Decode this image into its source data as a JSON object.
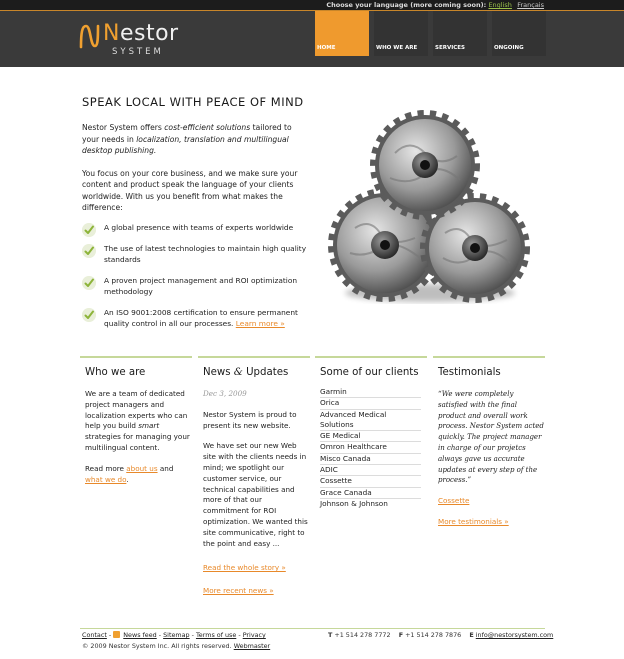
{
  "language_bar": {
    "prompt": "Choose your language (more coming soon):",
    "english": "English",
    "french": "Français"
  },
  "logo": {
    "name_initial": "N",
    "name_rest": "estor",
    "tagline": "SYSTEM"
  },
  "nav": [
    {
      "label": "HOME",
      "active": true
    },
    {
      "label": "WHO WE ARE",
      "active": false
    },
    {
      "label": "SERVICES",
      "active": false
    },
    {
      "label": "ONGOING",
      "active": false
    }
  ],
  "hero": {
    "title": "SPEAK LOCAL WITH PEACE OF MIND",
    "p1": {
      "a": "Nestor System offers ",
      "b": "cost-efficient solutions",
      "c": " tailored to your needs in ",
      "d": "localization, translation and multilingual desktop publishing."
    },
    "p2": "You focus on your core business, and we make sure your content and product speak the language of your clients worldwide. With us you benefit from what makes the difference:",
    "benefits": [
      "A global presence with teams of experts worldwide",
      "The use of latest technologies to maintain high quality standards",
      "A proven project management and ROI optimization methodology",
      "An ISO 9001:2008 certification to ensure permanent quality control in all our processes."
    ],
    "learn_more": "Learn more »"
  },
  "who": {
    "title": "Who we are",
    "text_a": "We are a team of dedicated project managers and localization experts who can help you build ",
    "text_em": "smart",
    "text_b": " strategies for managing your multilingual content.",
    "read_more": "Read more ",
    "link1": "about us",
    "and": " and",
    "link2": "what we do",
    "period": "."
  },
  "news": {
    "title_a": "News ",
    "title_amp": "&",
    "title_b": " Updates",
    "date": "Dec 3, 2009",
    "p1": "Nestor System is proud to present its new website.",
    "p2": "We have set our new Web site with the clients needs in mind; we spotlight our customer service, our technical capabilities and more of that our commitment for ROI optimization. We wanted this site communicative, right to the point and easy ...",
    "read_whole": "Read the whole story »",
    "more_news": "More recent news »"
  },
  "clients": {
    "title": "Some of our clients",
    "list": [
      "Garmin",
      "Orica",
      "Advanced Medical Solutions",
      "GE Medical",
      "Omron Healthcare",
      "Misco Canada",
      "ADIC",
      "Cossette",
      "Grace Canada",
      "Johnson & Johnson"
    ]
  },
  "testimonials": {
    "title": "Testimonials",
    "quote": "“We were completely satisfied with the final product and overall work process. Nestor System acted quickly. The project manager in charge of our projetcs always gave us accurate updates at every step of the process.”",
    "source": "Cossette",
    "more": "More testimonials »"
  },
  "footer": {
    "links": [
      "Contact",
      "News feed",
      "Sitemap",
      "Terms of use",
      "Privacy"
    ],
    "phone_label": "T",
    "phone": "+1 514 278 7772",
    "fax_label": "F",
    "fax": "+1 514 278 7876",
    "email_label": "E",
    "email": "info@nestorsystem.com",
    "copyright": "© 2009 Nestor System Inc. All rights reserved.",
    "webmaster": "Webmaster"
  },
  "colors": {
    "accent": "#ef9a2e",
    "green": "#9ac04b",
    "header": "#3a3a3a"
  }
}
